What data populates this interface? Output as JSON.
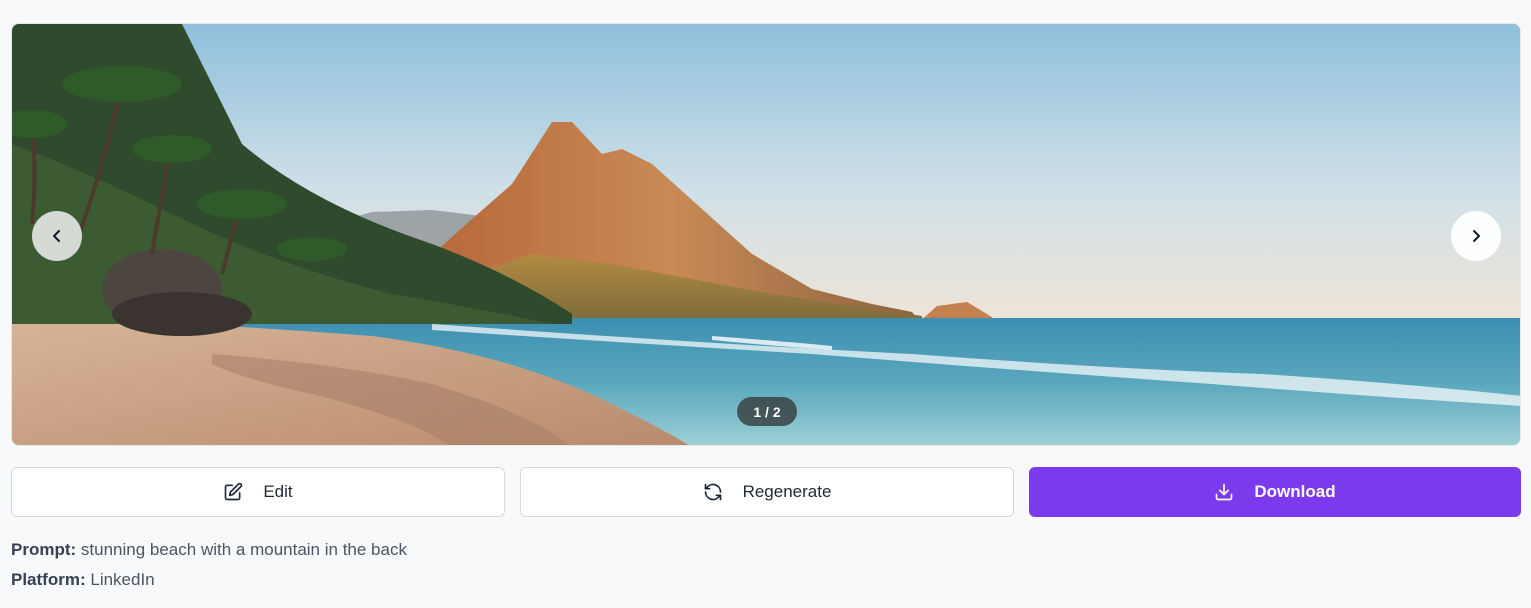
{
  "carousel": {
    "image_alt": "stunning beach with a mountain in the back",
    "counter": "1 / 2",
    "prev_icon": "chevron-left-icon",
    "next_icon": "chevron-right-icon"
  },
  "actions": {
    "edit_label": "Edit",
    "edit_icon": "edit-icon",
    "regenerate_label": "Regenerate",
    "regenerate_icon": "refresh-icon",
    "download_label": "Download",
    "download_icon": "download-icon"
  },
  "meta": {
    "prompt_label": "Prompt:",
    "prompt_value": "stunning beach with a mountain in the back",
    "platform_label": "Platform:",
    "platform_value": "LinkedIn"
  },
  "colors": {
    "primary": "#7c3aed",
    "background": "#f8f9fb"
  }
}
